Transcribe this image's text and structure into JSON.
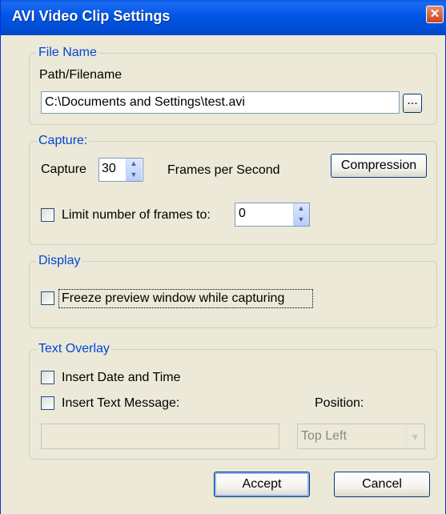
{
  "window": {
    "title": "AVI Video Clip Settings",
    "close_glyph": "✕"
  },
  "file_name": {
    "legend": "File Name",
    "path_label": "Path/Filename",
    "path_value": "C:\\Documents and Settings\\test.avi",
    "browse_label": "..."
  },
  "capture": {
    "legend": "Capture:",
    "capture_label": "Capture",
    "fps_value": "30",
    "fps_label": "Frames per Second",
    "compression_label": "Compression",
    "limit_label": "Limit number of frames to:",
    "limit_value": "0",
    "limit_checked": false
  },
  "display": {
    "legend": "Display",
    "freeze_label": "Freeze preview window while capturing",
    "freeze_checked": false
  },
  "text_overlay": {
    "legend": "Text Overlay",
    "date_time_label": "Insert Date and Time",
    "date_time_checked": false,
    "text_message_label": "Insert Text Message:",
    "text_message_checked": false,
    "text_message_value": "",
    "position_label": "Position:",
    "position_value": "Top Left"
  },
  "buttons": {
    "accept": "Accept",
    "cancel": "Cancel"
  }
}
